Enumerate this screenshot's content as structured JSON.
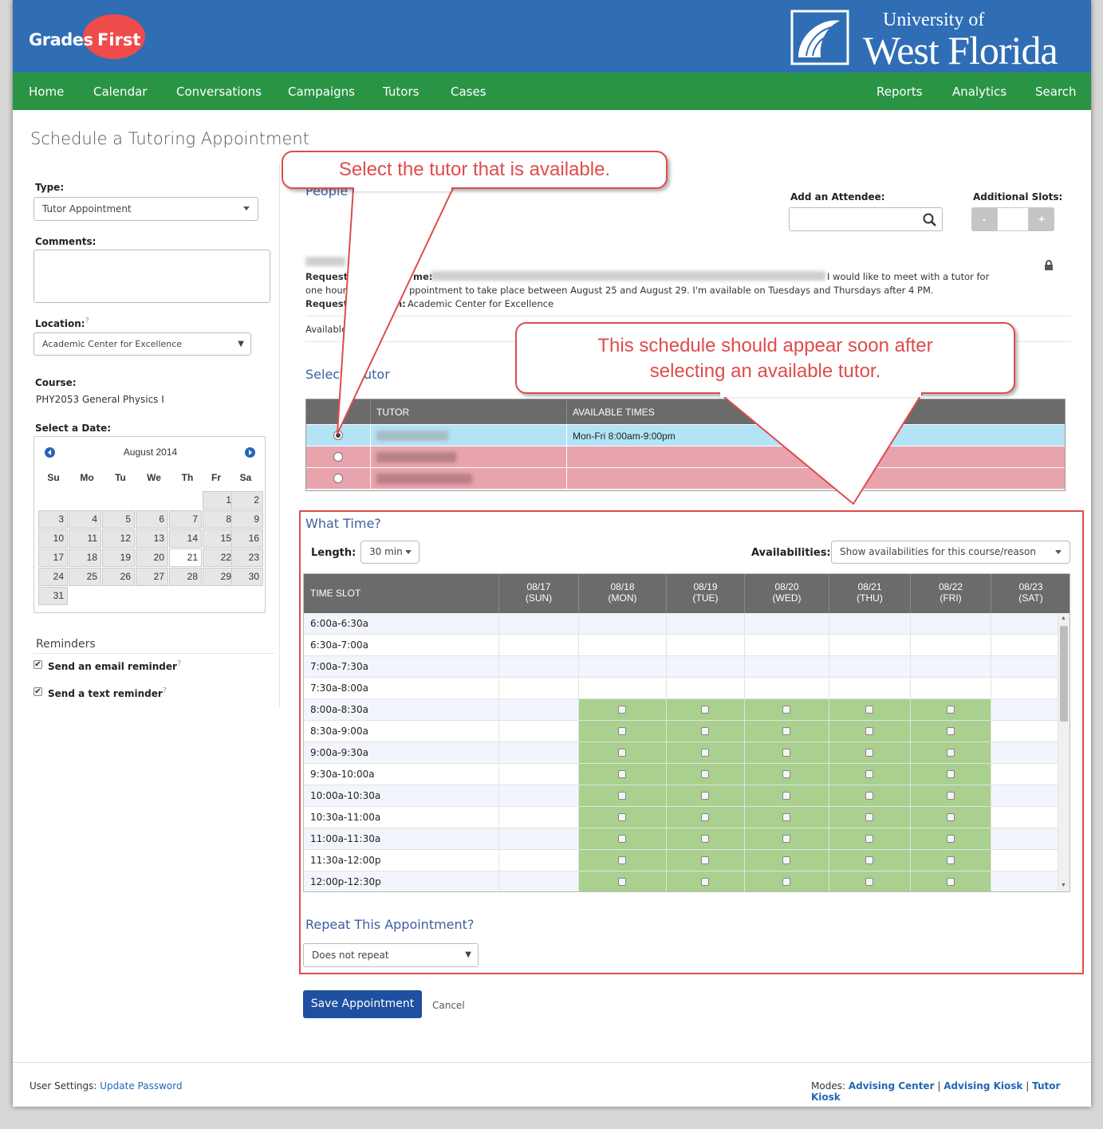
{
  "header": {
    "brand_left_a": "Grades",
    "brand_left_b": "First",
    "brand_right_l1": "University of",
    "brand_right_l2": "West Florida"
  },
  "nav": {
    "left": [
      "Home",
      "Calendar",
      "Conversations",
      "Campaigns",
      "Tutors",
      "Cases"
    ],
    "right": [
      "Reports",
      "Analytics",
      "Search"
    ]
  },
  "page_title": "Schedule a Tutoring Appointment",
  "form": {
    "type_label": "Type:",
    "type_value": "Tutor Appointment",
    "comments_label": "Comments:",
    "location_label": "Location:",
    "location_help": "?",
    "location_value": "Academic Center for Excellence",
    "course_label": "Course:",
    "course_value": "PHY2053 General Physics I",
    "date_label": "Select a Date:"
  },
  "calendar": {
    "month": "August 2014",
    "dow": [
      "Su",
      "Mo",
      "Tu",
      "We",
      "Th",
      "Fr",
      "Sa"
    ],
    "selected_day": "21"
  },
  "reminders": {
    "title": "Reminders",
    "email": "Send an email reminder",
    "text": "Send a text reminder",
    "help": "?"
  },
  "people": {
    "title": "People",
    "add_attendee_label": "Add an Attendee:",
    "additional_slots_label": "Additional Slots:",
    "minus": "-",
    "plus": "+"
  },
  "request": {
    "label_a": "Requeste",
    "label_a2": "me:",
    "text_a": "I would like to meet with a tutor for",
    "text_b": "one hour",
    "text_c": "ppointment to take place between August 25 and August 29. I'm available on Tuesdays and Thursdays after 4 PM.",
    "label_b": "Request",
    "label_b2": "n:",
    "text_d": "Academic Center for Excellence",
    "available": "Available"
  },
  "select_tutor": {
    "title_a": "Select",
    "title_b": "utor",
    "col_tutor": "TUTOR",
    "col_times": "AVAILABLE TIMES",
    "row1_times": "Mon-Fri 8:00am-9:00pm"
  },
  "what_time": {
    "title": "What Time?",
    "length_label": "Length:",
    "length_value": "30 min",
    "avail_label": "Availabilities:",
    "avail_value": "Show availabilities for this course/reason",
    "col_slot": "TIME SLOT",
    "days": [
      {
        "date": "08/17",
        "dow": "(SUN)"
      },
      {
        "date": "08/18",
        "dow": "(MON)"
      },
      {
        "date": "08/19",
        "dow": "(TUE)"
      },
      {
        "date": "08/20",
        "dow": "(WED)"
      },
      {
        "date": "08/21",
        "dow": "(THU)"
      },
      {
        "date": "08/22",
        "dow": "(FRI)"
      },
      {
        "date": "08/23",
        "dow": "(SAT)"
      }
    ],
    "slots": [
      "6:00a-6:30a",
      "6:30a-7:00a",
      "7:00a-7:30a",
      "7:30a-8:00a",
      "8:00a-8:30a",
      "8:30a-9:00a",
      "9:00a-9:30a",
      "9:30a-10:00a",
      "10:00a-10:30a",
      "10:30a-11:00a",
      "11:00a-11:30a",
      "11:30a-12:00p",
      "12:00p-12:30p"
    ],
    "available_from_slot_index": 4,
    "available_day_indices": [
      1,
      2,
      3,
      4,
      5
    ]
  },
  "repeat": {
    "title": "Repeat This Appointment?",
    "value": "Does not repeat"
  },
  "actions": {
    "save": "Save Appointment",
    "cancel": "Cancel"
  },
  "callouts": {
    "tutor": "Select the tutor that is available.",
    "schedule_l1": "This schedule should appear soon after",
    "schedule_l2": "selecting an available tutor."
  },
  "footer": {
    "settings_label": "User Settings:",
    "update_password": "Update Password",
    "modes_label": "Modes:",
    "mode1": "Advising Center",
    "mode2": "Advising Kiosk",
    "mode3": "Tutor Kiosk",
    "sep": "|"
  },
  "colors": {
    "header_blue": "#2f6eb5",
    "nav_green": "#2a9445",
    "available_green": "#a9d08e",
    "selected_row": "#b3e3f5",
    "unavailable_row": "#e8a3ad",
    "callout_red": "#e04b4b"
  }
}
